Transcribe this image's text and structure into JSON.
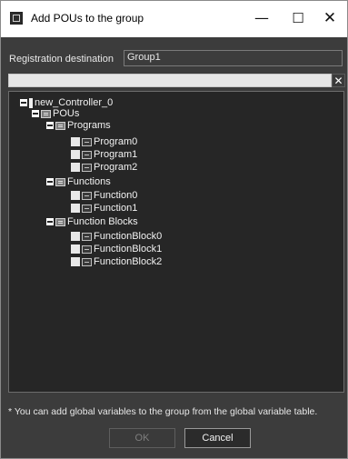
{
  "window": {
    "title": "Add POUs to the group",
    "minimize_glyph": "—",
    "maximize_glyph": "☐",
    "close_glyph": "✕"
  },
  "registration": {
    "label": "Registration destination",
    "value": "Group1"
  },
  "search": {
    "value": "",
    "clear_glyph": "✕"
  },
  "tree": {
    "controller": "new_Controller_0",
    "pous": "POUs",
    "programs": {
      "label": "Programs",
      "items": [
        "Program0",
        "Program1",
        "Program2"
      ]
    },
    "functions": {
      "label": "Functions",
      "items": [
        "Function0",
        "Function1"
      ]
    },
    "function_blocks": {
      "label": "Function Blocks",
      "items": [
        "FunctionBlock0",
        "FunctionBlock1",
        "FunctionBlock2"
      ]
    }
  },
  "note": "* You can add global variables to the group from the global variable table.",
  "buttons": {
    "ok": "OK",
    "cancel": "Cancel"
  },
  "icons": {
    "app": "dialog-app-icon",
    "expander": "collapse-icon",
    "folder": "folder-icon",
    "pou": "pou-icon",
    "checkbox": "checkbox-icon"
  }
}
